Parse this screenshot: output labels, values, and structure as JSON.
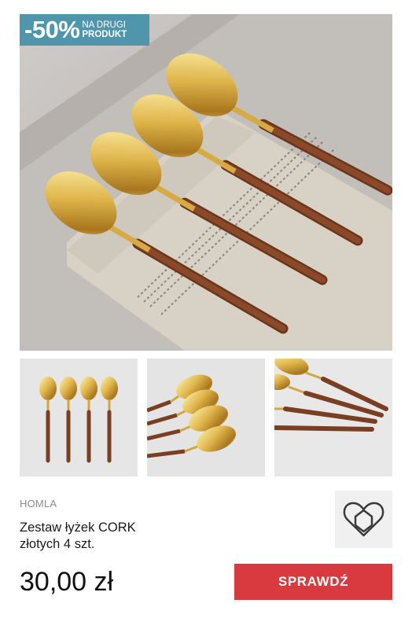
{
  "badge": {
    "percent": "-50%",
    "line1": "NA DRUGI",
    "line2": "PRODUKT"
  },
  "product": {
    "brand": "HOMLA",
    "title_line1": "Zestaw łyżek CORK",
    "title_line2": "złotych 4 szt.",
    "price": "30,00 zł",
    "button_label": "SPRAWDŹ"
  },
  "colors": {
    "accent_red": "#d83a3f",
    "badge_blue": "#4f96ac",
    "gold": "#d9b04a",
    "wood": "#7a3f22"
  },
  "icons": {
    "brand_logo": "heart-house-logo-icon"
  }
}
